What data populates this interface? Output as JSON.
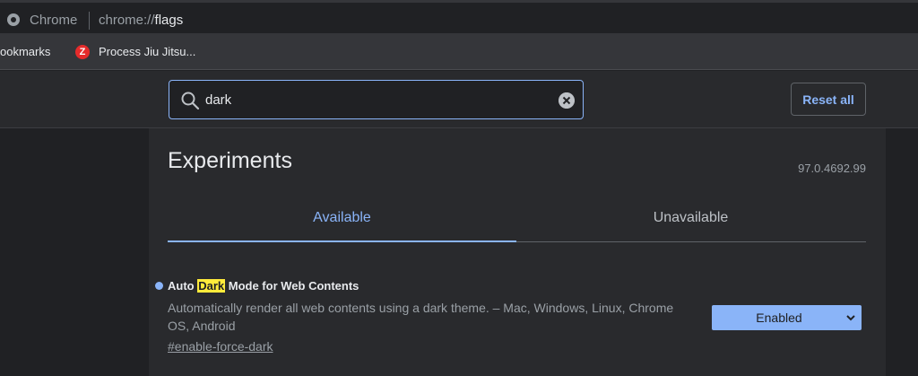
{
  "omnibox": {
    "site_name": "Chrome",
    "url_scheme": "chrome://",
    "url_host": "flags",
    "site_icon": "chrome-icon"
  },
  "bookmarks": {
    "items": [
      {
        "label": "ookmarks"
      },
      {
        "label": "Process Jiu Jitsu...",
        "favicon_letter": "Z",
        "icon": "process-jiu-jitsu-favicon"
      }
    ]
  },
  "header": {
    "search": {
      "value": "dark",
      "icon": "search-icon",
      "clear_icon": "clear-icon"
    },
    "reset_label": "Reset all"
  },
  "main": {
    "title": "Experiments",
    "version": "97.0.4692.99",
    "tabs": [
      {
        "label": "Available",
        "active": true
      },
      {
        "label": "Unavailable",
        "active": false
      }
    ],
    "flag": {
      "title_before": "Auto ",
      "title_highlight": "Dark",
      "title_after": " Mode for Web Contents",
      "description": "Automatically render all web contents using a dark theme. – Mac, Windows, Linux, Chrome OS, Android",
      "link": "#enable-force-dark",
      "selected_option": "Enabled"
    }
  },
  "colors": {
    "accent": "#8ab4f8",
    "highlight": "#ffeb3b",
    "background": "#202124",
    "surface": "#292a2d"
  }
}
